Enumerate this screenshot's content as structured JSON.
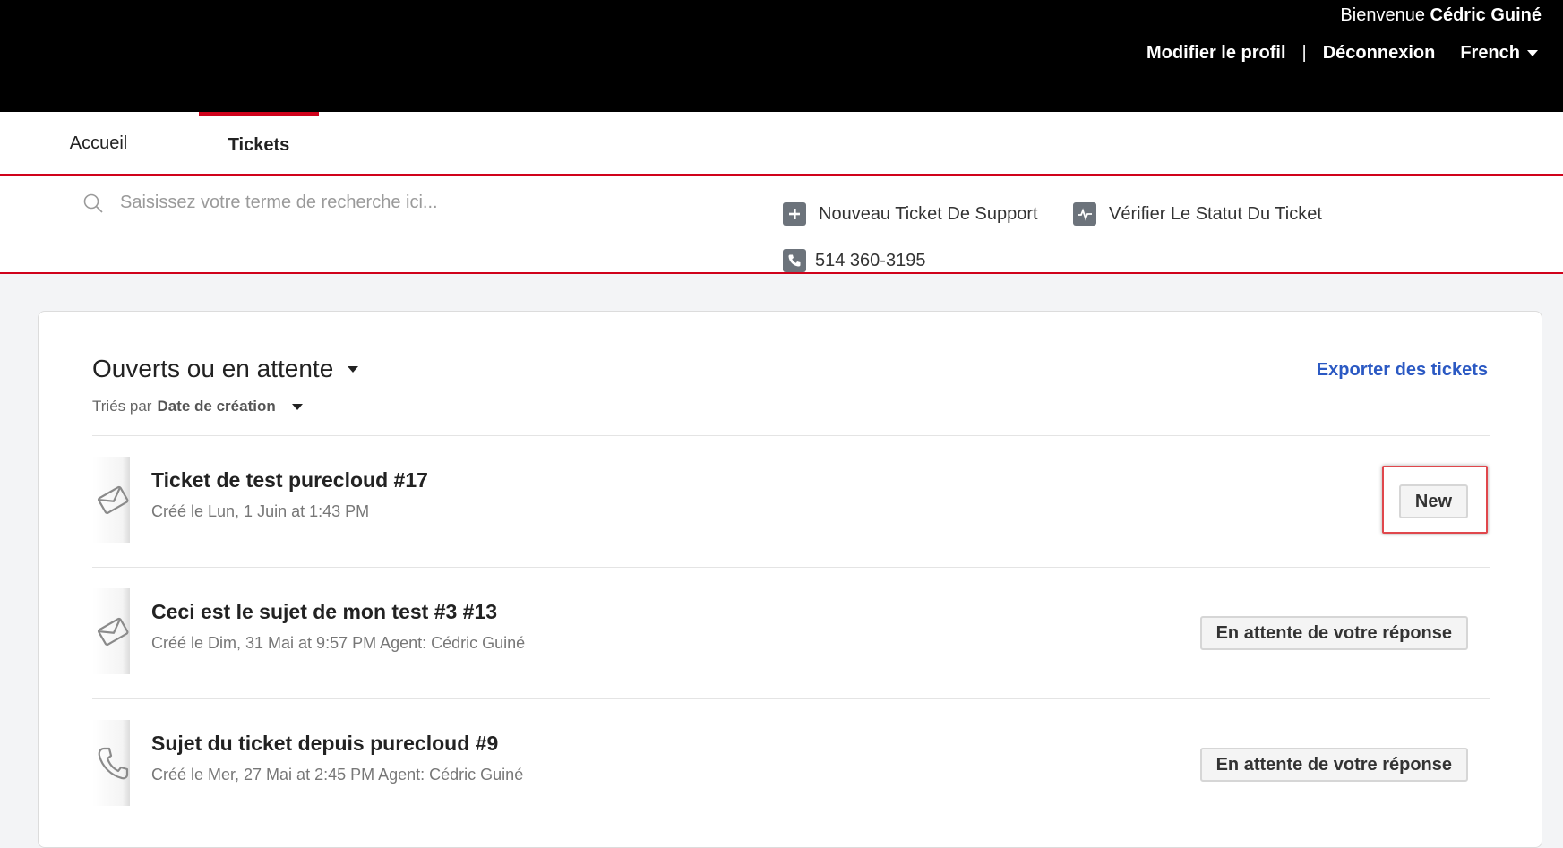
{
  "header": {
    "welcome_prefix": "Bienvenue",
    "user_name": "Cédric Guiné",
    "edit_profile": "Modifier le profil",
    "separator": "|",
    "logout": "Déconnexion",
    "language": "French"
  },
  "tabs": [
    {
      "label": "Accueil",
      "active": false
    },
    {
      "label": "Tickets",
      "active": true
    }
  ],
  "search": {
    "placeholder": "Saisissez votre terme de recherche ici..."
  },
  "actions": {
    "new_ticket": "Nouveau Ticket De Support",
    "check_status": "Vérifier Le Statut Du Ticket",
    "phone": "514 360-3195"
  },
  "list_header": {
    "filter_label": "Ouverts ou en attente",
    "sorted_by_prefix": "Triés par",
    "sorted_by_value": "Date de création",
    "export_label": "Exporter des tickets"
  },
  "tickets": [
    {
      "subject": "Ticket de test purecloud #17",
      "meta": "Créé le Lun, 1 Juin at 1:43 PM",
      "status": "New",
      "icon": "envelope-icon",
      "highlighted": true
    },
    {
      "subject": "Ceci est le sujet de mon test #3 #13",
      "meta": "Créé le Dim, 31 Mai at 9:57 PM Agent: Cédric Guiné",
      "status": "En attente de votre réponse",
      "icon": "envelope-icon",
      "highlighted": false
    },
    {
      "subject": "Sujet du ticket depuis purecloud #9",
      "meta": "Créé le Mer, 27 Mai at 2:45 PM Agent: Cédric Guiné",
      "status": "En attente de votre réponse",
      "icon": "phone-icon",
      "highlighted": false
    }
  ],
  "colors": {
    "accent_red": "#d0021b",
    "link_blue": "#2b59c3",
    "header_bg": "#000000",
    "icon_gray": "#6c737b",
    "highlight_red": "#e0474c"
  }
}
